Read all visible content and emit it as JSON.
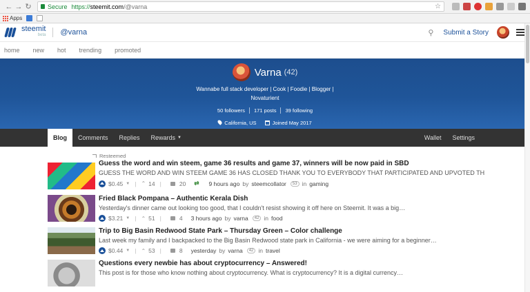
{
  "browser": {
    "secure_label": "Secure",
    "url_scheme": "https://",
    "url_host": "steemit.com",
    "url_path": "/@varna",
    "bookmarks": [
      {
        "label": "Apps"
      }
    ]
  },
  "header": {
    "brand": "steemit",
    "beta": "beta",
    "username": "@varna",
    "submit_label": "Submit a Story"
  },
  "sort_tabs": [
    "home",
    "new",
    "hot",
    "trending",
    "promoted"
  ],
  "profile": {
    "name": "Varna",
    "reputation": "(42)",
    "about": "Wannabe full stack developer | Cook | Foodie | Blogger | Novaturient",
    "followers": "50 followers",
    "posts": "171 posts",
    "following": "39 following",
    "location": "California, US",
    "joined": "Joined May 2017",
    "banner_color": "#1f5599"
  },
  "user_tabs": {
    "left": [
      "Blog",
      "Comments",
      "Replies",
      "Rewards"
    ],
    "right": [
      "Wallet",
      "Settings"
    ],
    "active": "Blog"
  },
  "posts": [
    {
      "resteemed": "Resteemed",
      "title": "Guess the word and win steem, game 36 results and game 37, winners will be now paid in SBD",
      "excerpt": "GUESS THE WORD AND WIN STEEM GAME 36 HAS CLOSED THANK YOU TO EVERYBODY THAT PARTICIPATED AND UPVOTED TH..",
      "payout": "$0.45",
      "votes": "14",
      "comments": "20",
      "time": "9 hours ago",
      "by": "by",
      "author": "steemcollator",
      "rep": "53",
      "in": "in",
      "category": "gaming"
    },
    {
      "title": "Fried Black Pompana – Authentic Kerala Dish",
      "excerpt": "Yesterday's dinner came out looking too good, that I couldn't resist showing it off here on Steemit. It was a big…",
      "payout": "$3.21",
      "votes": "51",
      "comments": "4",
      "time": "3 hours ago",
      "by": "by",
      "author": "varna",
      "rep": "42",
      "in": "in",
      "category": "food"
    },
    {
      "title": "Trip to Big Basin Redwood State Park – Thursday Green – Color challenge",
      "excerpt": "Last week my family and I backpacked to the Big Basin Redwood state park in California - we were aiming for a beginner…",
      "payout": "$0.44",
      "votes": "53",
      "comments": "8",
      "time": "yesterday",
      "by": "by",
      "author": "varna",
      "rep": "42",
      "in": "in",
      "category": "travel"
    },
    {
      "title": "Questions every newbie has about cryptocurrency – Answered!",
      "excerpt": "This post is for those who know nothing about cryptocurrency. What is cryptocurrency? It is a digital currency…"
    }
  ]
}
